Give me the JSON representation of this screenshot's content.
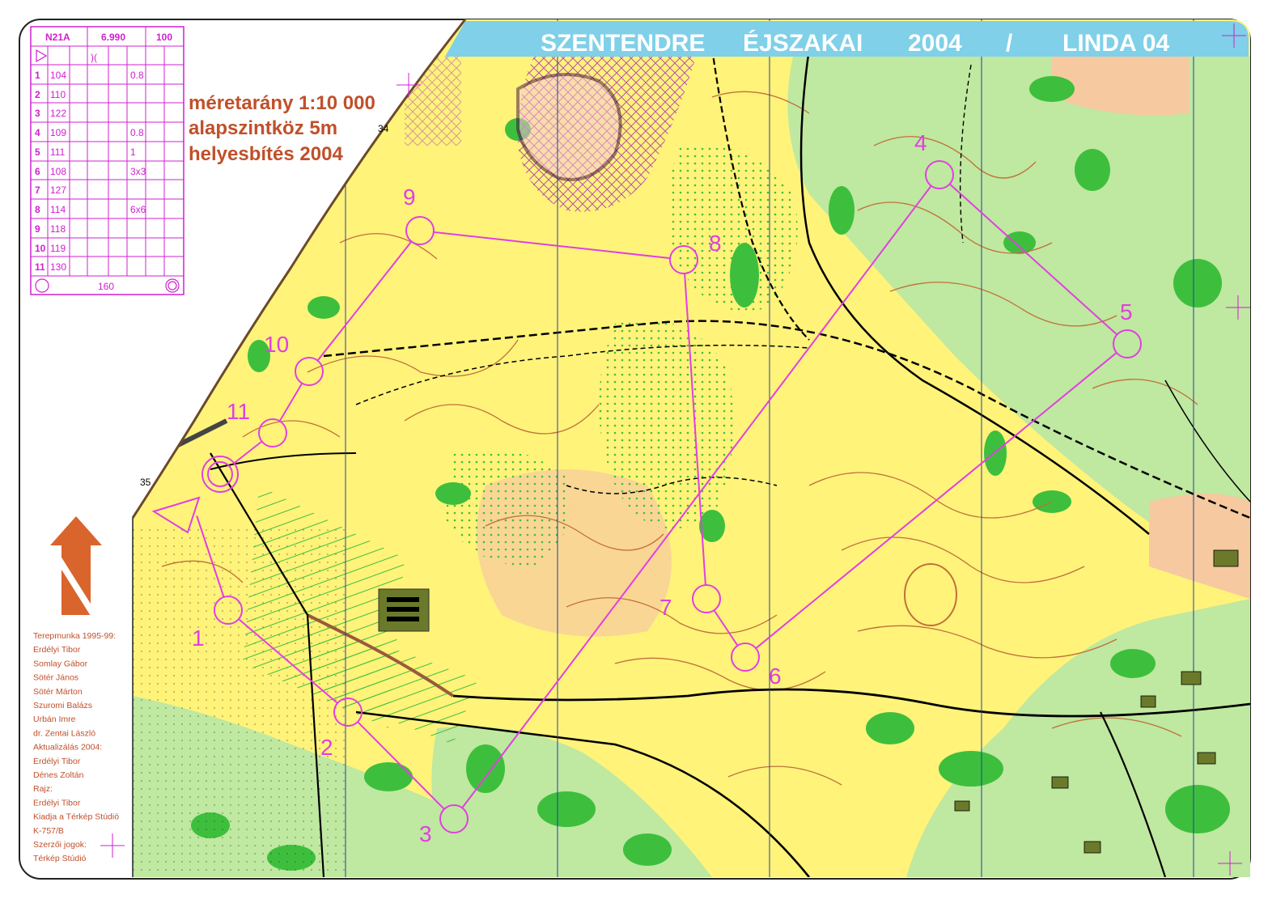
{
  "title": {
    "parts": [
      "SZENTENDRE",
      "ÉJSZAKAI",
      "2004",
      "/",
      "LINDA 04"
    ]
  },
  "scale_info": {
    "line1": "méretarány 1:10 000",
    "line2": "alapszintköz 5m",
    "line3": "helyesbítés 2004"
  },
  "control_description": {
    "header": [
      "N21A",
      "6.990",
      "100"
    ],
    "rows": [
      {
        "n": "1",
        "code": "104",
        "d": "0.8"
      },
      {
        "n": "2",
        "code": "110",
        "d": ""
      },
      {
        "n": "3",
        "code": "122",
        "d": ""
      },
      {
        "n": "4",
        "code": "109",
        "d": "0.8"
      },
      {
        "n": "5",
        "code": "111",
        "d": "1"
      },
      {
        "n": "6",
        "code": "108",
        "d": "3x3"
      },
      {
        "n": "7",
        "code": "127",
        "d": ""
      },
      {
        "n": "8",
        "code": "114",
        "d": "6x6"
      },
      {
        "n": "9",
        "code": "118",
        "d": ""
      },
      {
        "n": "10",
        "code": "119",
        "d": ""
      },
      {
        "n": "11",
        "code": "130",
        "d": ""
      }
    ],
    "finish_distance": "160"
  },
  "credits": [
    "Terepmunka 1995-99:",
    "Erdélyi Tibor",
    "Somlay Gábor",
    "Sötér János",
    "Sötér Márton",
    "Szuromi Balázs",
    "Urbán Imre",
    "dr. Zentai László",
    "Aktualizálás 2004:",
    "Erdélyi Tibor",
    "Dénes Zoltán",
    "Rajz:",
    "Erdélyi Tibor",
    "Kiadja a Térkép Stúdió",
    "K-757/B",
    "Szerzői jogok:",
    "Térkép Stúdió"
  ],
  "controls": [
    {
      "label": "1"
    },
    {
      "label": "2"
    },
    {
      "label": "3"
    },
    {
      "label": "4"
    },
    {
      "label": "5"
    },
    {
      "label": "6"
    },
    {
      "label": "7"
    },
    {
      "label": "8"
    },
    {
      "label": "9"
    },
    {
      "label": "10"
    },
    {
      "label": "11"
    }
  ],
  "grid_numbers": {
    "n34": "34",
    "n35": "35"
  },
  "colors": {
    "course": "#e040e0",
    "open_yellow": "#fff37a",
    "forest_light": "#bfe8a0",
    "forest_green": "#3dbf3d",
    "contour": "#c0703a",
    "title_band": "#7fd0e8",
    "north": "#d9642c"
  }
}
